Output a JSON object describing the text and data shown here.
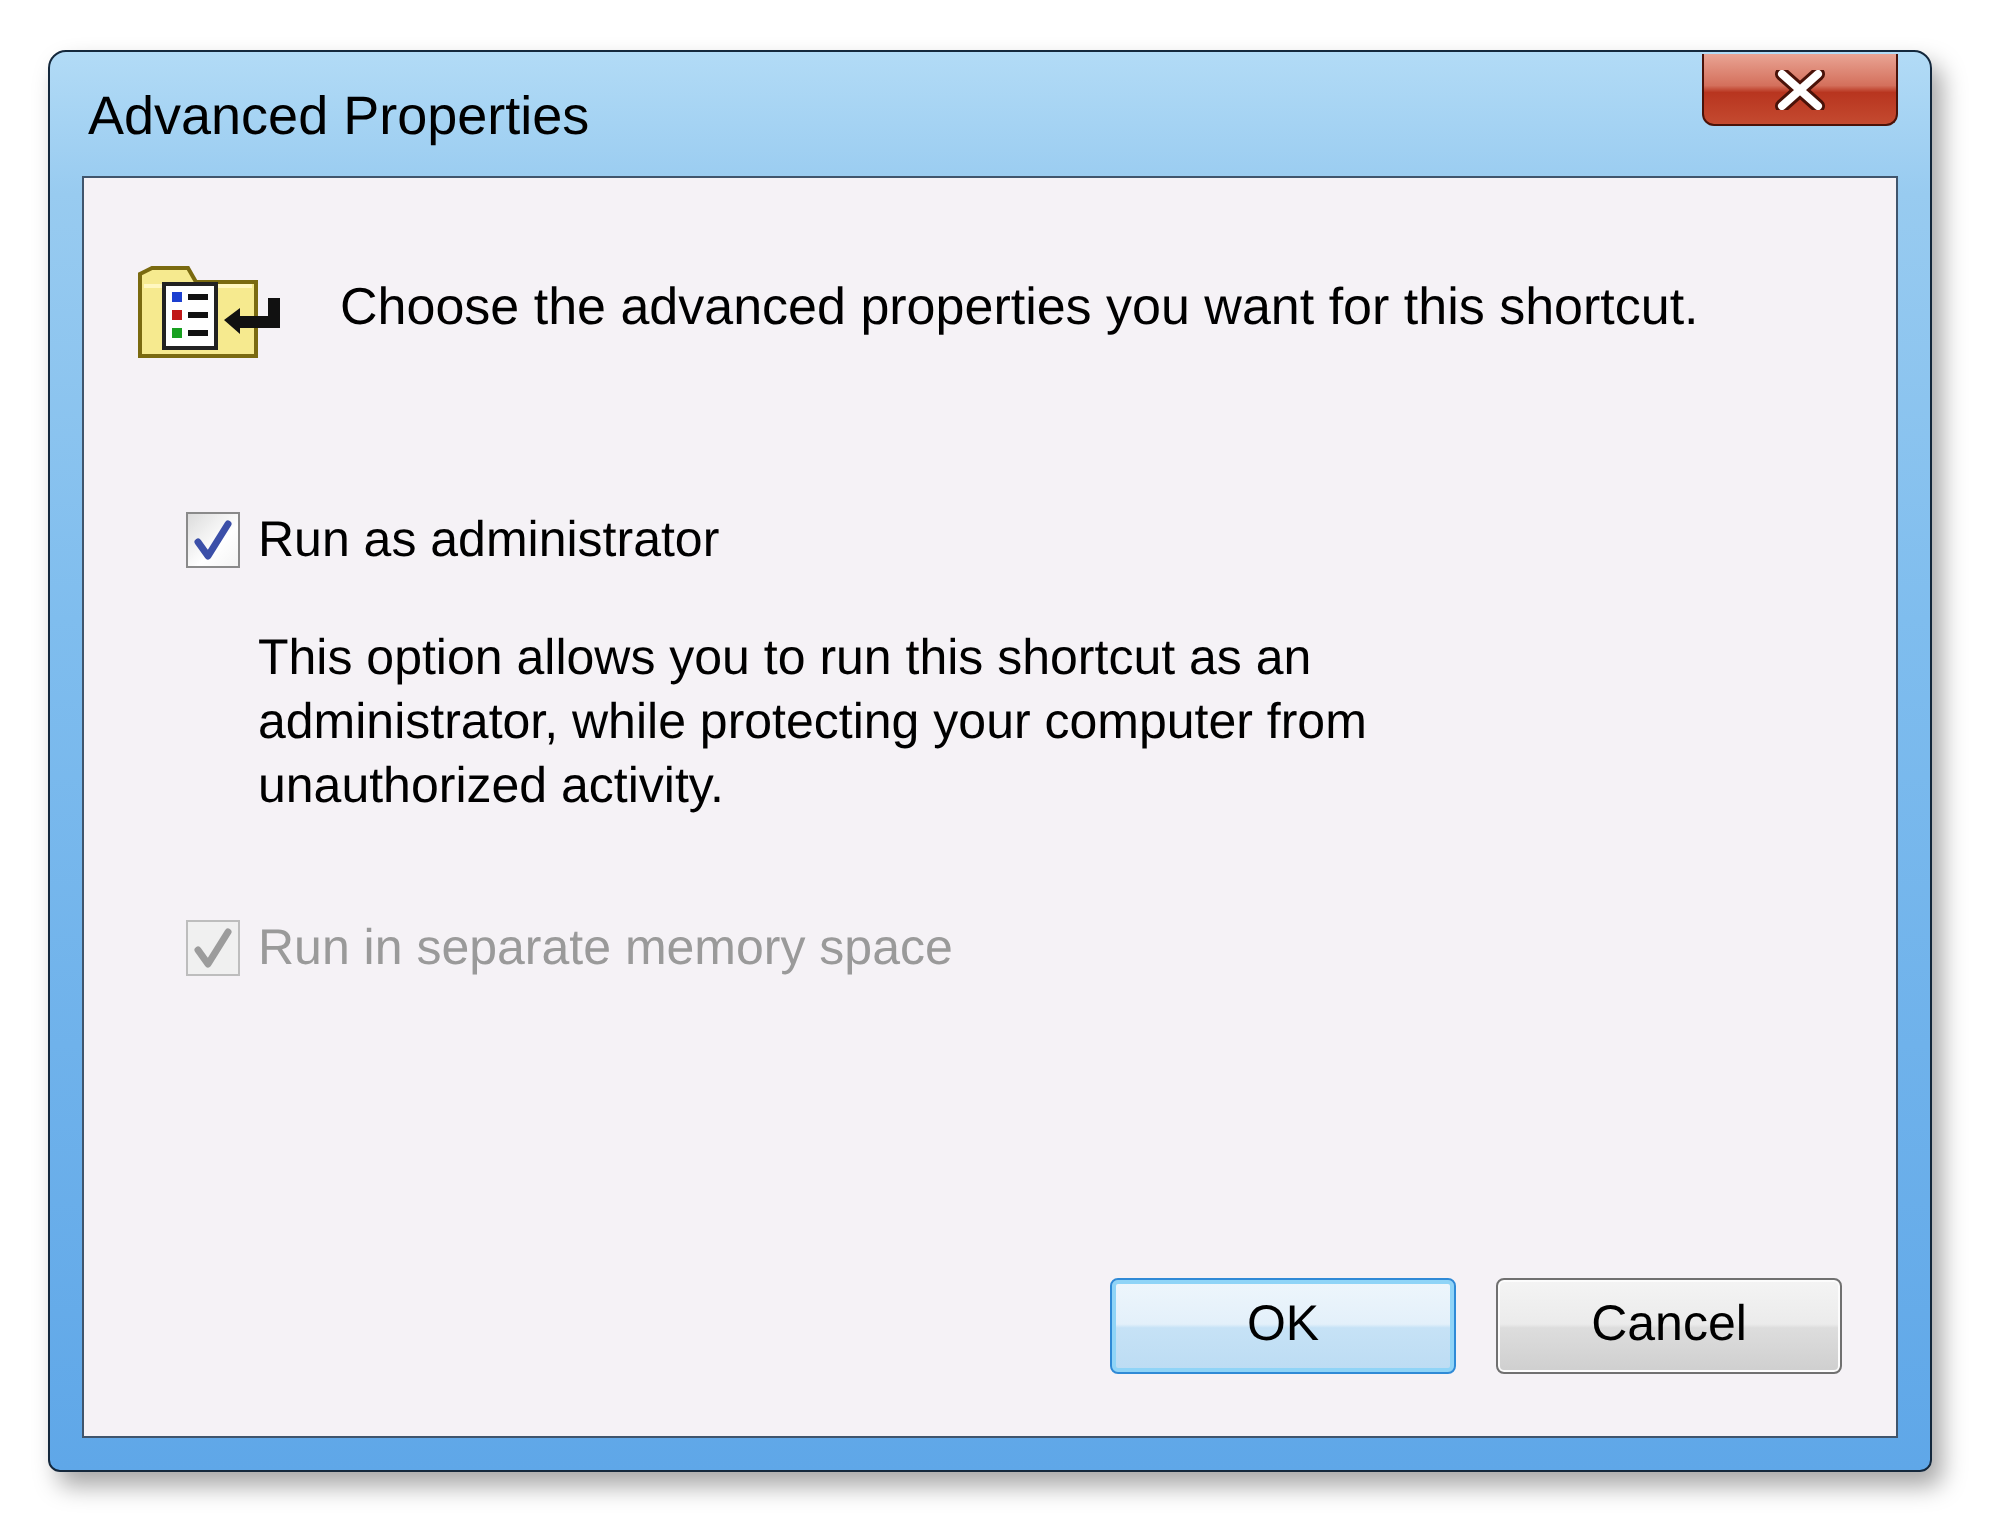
{
  "window": {
    "title": "Advanced Properties"
  },
  "header": {
    "text": "Choose the advanced properties you want for this shortcut."
  },
  "options": [
    {
      "label": "Run as administrator",
      "checked": true,
      "disabled": false,
      "description": "This option allows you to run this shortcut as an administrator, while protecting your computer from unauthorized activity."
    },
    {
      "label": "Run in separate memory space",
      "checked": true,
      "disabled": true
    }
  ],
  "buttons": [
    {
      "label": "OK",
      "default": true
    },
    {
      "label": "Cancel",
      "default": false
    }
  ]
}
